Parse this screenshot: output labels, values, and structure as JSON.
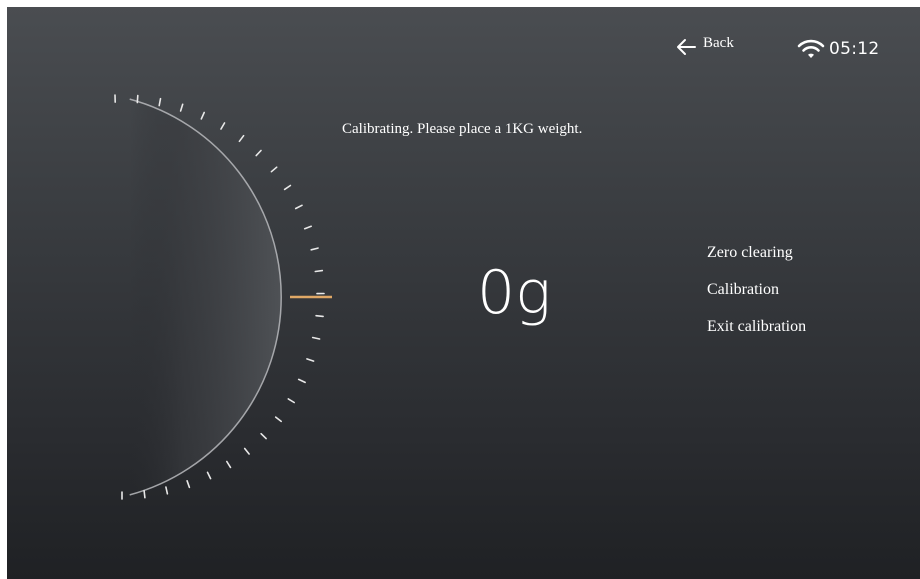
{
  "header": {
    "back_label": "Back",
    "time": "05:12"
  },
  "icons": {
    "back": "arrow-left-icon",
    "wifi": "wifi-icon"
  },
  "main": {
    "status_message": "Calibrating. Please place a 1KG weight.",
    "weight_reading": "0g"
  },
  "menu": {
    "items": [
      {
        "label": "Zero clearing"
      },
      {
        "label": "Calibration"
      },
      {
        "label": "Exit calibration"
      }
    ]
  },
  "colors": {
    "needle": "#e0a866",
    "background_top": "#4a4d51",
    "background_bottom": "#1f2124"
  }
}
